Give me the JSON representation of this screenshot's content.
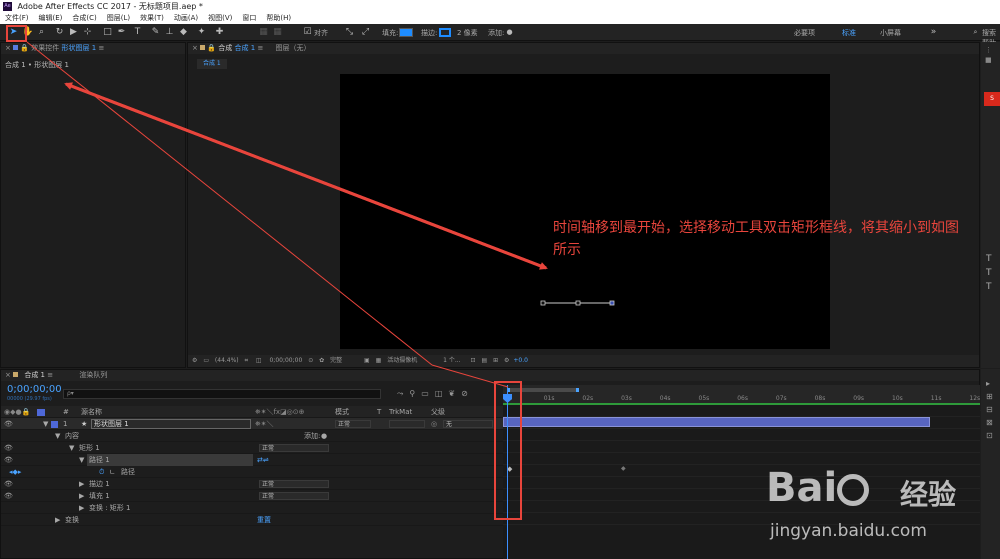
{
  "window": {
    "title": "Adobe After Effects CC 2017 - 无标题项目.aep *",
    "app_badge": "Ae"
  },
  "menu": [
    "文件(F)",
    "编辑(E)",
    "合成(C)",
    "图层(L)",
    "效果(T)",
    "动画(A)",
    "视图(V)",
    "窗口",
    "帮助(H)"
  ],
  "toolbar": {
    "align_label": "对齐",
    "fill_label": "填充:",
    "stroke_label": "描边:",
    "stroke_value": "2 像素",
    "add_label": "添加:",
    "workspaces": [
      "必要项",
      "标准",
      "小屏幕"
    ],
    "search_placeholder": "搜索帮助"
  },
  "effects_panel": {
    "tab_prefix": "效果控件",
    "tab_layer": "形状图层 1",
    "breadcrumb": "合成 1 • 形状图层 1"
  },
  "comp_panel": {
    "tab_label": "合成",
    "tab_name": "合成 1",
    "layer_tab": "图层（无）",
    "sub_tab": "合成 1",
    "zoom": "(44.4%)",
    "timecode": "0;00;00;00",
    "quality": "完整",
    "camera": "活动摄像机",
    "views": "1 个...",
    "exposure": "+0.0"
  },
  "annotation": "时间轴移到最开始，选择移动工具双击矩形框线，将其缩小到如图所示",
  "timeline": {
    "tab_comp": "合成 1",
    "tab_render": "渲染队列",
    "timecode": "0;00;00;00",
    "timecode_sub": "00000 (29.97 fps)",
    "search_placeholder": "ρ▾",
    "col_hash": "#",
    "col_source": "源名称",
    "col_mode": "模式",
    "col_t": "T",
    "col_trkmat": "TrkMat",
    "col_parent": "父级",
    "ticks": [
      "0s",
      "01s",
      "02s",
      "03s",
      "04s",
      "05s",
      "06s",
      "07s",
      "08s",
      "09s",
      "10s",
      "11s",
      "12s"
    ],
    "rows": [
      {
        "num": "1",
        "name": "形状图层 1",
        "mode": "正常",
        "parent": "无"
      },
      {
        "label": "内容",
        "add": "添加:"
      },
      {
        "label": "矩形 1",
        "mode": "正常"
      },
      {
        "label": "路径 1"
      },
      {
        "label": "路径"
      },
      {
        "label": "描边 1",
        "mode": "正常"
      },
      {
        "label": "填充 1",
        "mode": "正常"
      },
      {
        "label": "变换 : 矩形 1"
      },
      {
        "label": "变换",
        "reset": "重置"
      }
    ]
  },
  "watermark": {
    "brand": "Bai",
    "brand_cn": "经验",
    "url": "jingyan.baidu.com"
  },
  "colors": {
    "accent": "#3c8fff",
    "annotation": "#e8453c",
    "layer_bar": "#5865c0",
    "work_area": "#2e9a3a"
  }
}
